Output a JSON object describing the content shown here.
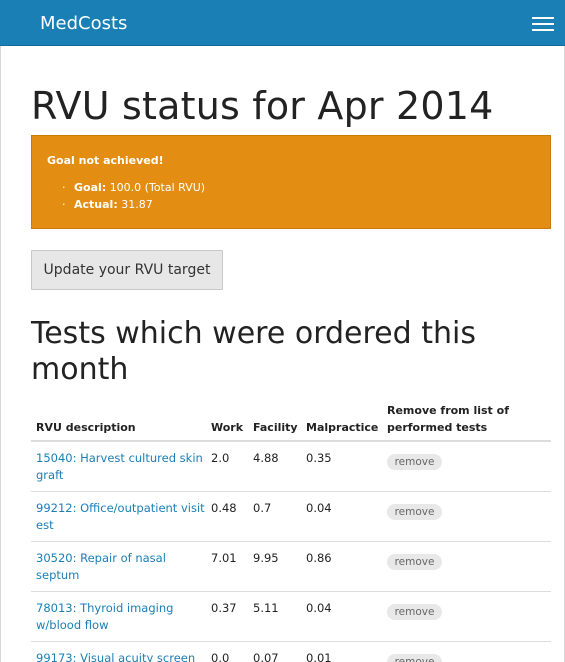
{
  "navbar": {
    "brand": "MedCosts",
    "menu_icon": "hamburger-icon"
  },
  "page": {
    "title": "RVU status for Apr 2014"
  },
  "alert": {
    "heading": "Goal not achieved!",
    "items": [
      {
        "label": "Goal:",
        "value": "100.0 (Total RVU)"
      },
      {
        "label": "Actual:",
        "value": "31.87"
      }
    ],
    "color": "#e38d13"
  },
  "buttons": {
    "update_target": "Update your RVU target"
  },
  "tests": {
    "title": "Tests which were ordered this month",
    "headers": {
      "description": "RVU description",
      "work": "Work",
      "facility": "Facility",
      "malpractice": "Malpractice",
      "remove": "Remove from list of performed tests"
    },
    "rows": [
      {
        "description": "15040: Harvest cultured skin graft",
        "work": "2.0",
        "facility": "4.88",
        "malpractice": "0.35",
        "remove": "remove"
      },
      {
        "description": "99212: Office/outpatient visit est",
        "work": "0.48",
        "facility": "0.7",
        "malpractice": "0.04",
        "remove": "remove"
      },
      {
        "description": "30520: Repair of nasal septum",
        "work": "7.01",
        "facility": "9.95",
        "malpractice": "0.86",
        "remove": "remove"
      },
      {
        "description": "78013: Thyroid imaging w/blood flow",
        "work": "0.37",
        "facility": "5.11",
        "malpractice": "0.04",
        "remove": "remove"
      },
      {
        "description": "99173: Visual acuity screen",
        "work": "0.0",
        "facility": "0.07",
        "malpractice": "0.01",
        "remove": "remove"
      }
    ]
  },
  "colors": {
    "navbar": "#1a7fb5",
    "link": "#1a7fb5",
    "alert": "#e38d13"
  }
}
